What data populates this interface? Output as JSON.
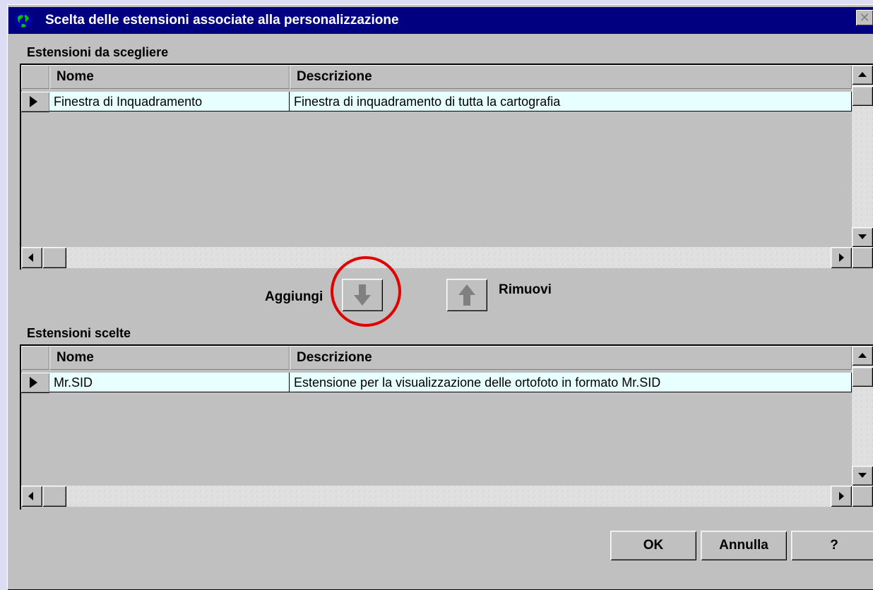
{
  "window": {
    "title": "Scelta delle estensioni associate alla personalizzazione",
    "close_symbol": "✕"
  },
  "available_grid": {
    "caption": "Estensioni da scegliere",
    "columns": [
      "Nome",
      "Descrizione"
    ],
    "rows": [
      {
        "nome": "Finestra di Inquadramento",
        "descrizione": "Finestra di inquadramento di tutta la cartografia"
      }
    ]
  },
  "actions": {
    "add_label": "Aggiungi",
    "remove_label": "Rimuovi",
    "add_icon": "arrow-down-icon",
    "remove_icon": "arrow-up-icon",
    "highlight_color": "#e00000"
  },
  "selected_grid": {
    "caption": "Estensioni scelte",
    "columns": [
      "Nome",
      "Descrizione"
    ],
    "rows": [
      {
        "nome": "Mr.SID",
        "descrizione": "Estensione per la visualizzazione delle ortofoto in formato Mr.SID"
      }
    ]
  },
  "buttons": {
    "ok_label": "OK",
    "cancel_label": "Annulla",
    "help_label": "?"
  },
  "colors": {
    "titlebar": "#000080",
    "row_background": "#e8ffff",
    "face": "#c0c0c0"
  }
}
